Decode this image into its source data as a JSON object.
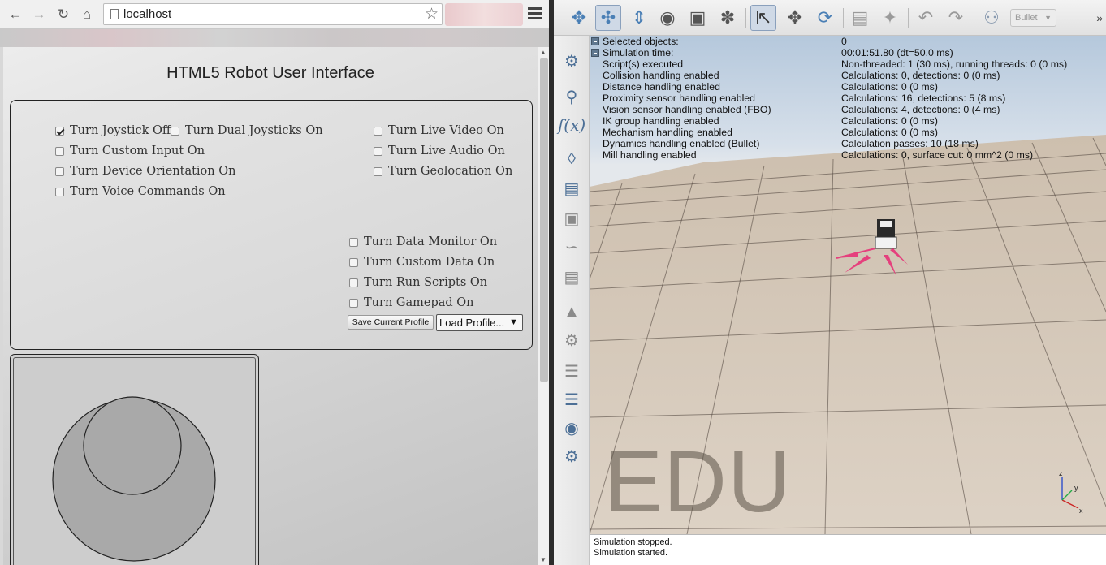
{
  "browser": {
    "url": "localhost",
    "page_title": "HTML5 Robot User Interface",
    "options_left": [
      {
        "label": "Turn Joystick Off",
        "checked": true
      },
      {
        "label": "Turn Dual Joysticks On",
        "checked": false
      },
      {
        "label": "Turn Custom Input On",
        "checked": false
      },
      {
        "label": "Turn Device Orientation On",
        "checked": false
      },
      {
        "label": "Turn Voice Commands On",
        "checked": false
      }
    ],
    "options_right": [
      {
        "label": "Turn Live Video On",
        "checked": false
      },
      {
        "label": "Turn Live Audio On",
        "checked": false
      },
      {
        "label": "Turn Geolocation On",
        "checked": false
      }
    ],
    "options_bottom": [
      {
        "label": "Turn Data Monitor On",
        "checked": false
      },
      {
        "label": "Turn Custom Data On",
        "checked": false
      },
      {
        "label": "Turn Run Scripts On",
        "checked": false
      },
      {
        "label": "Turn Gamepad On",
        "checked": false
      }
    ],
    "save_button": "Save Current Profile",
    "load_select": "Load Profile..."
  },
  "vrep": {
    "physics_engine": "Bullet",
    "info": [
      {
        "key": "Selected objects:",
        "value": "0"
      },
      {
        "key": "Simulation time:",
        "value": "00:01:51.80 (dt=50.0 ms)"
      },
      {
        "key": "Script(s) executed",
        "value": "Non-threaded: 1 (30 ms), running threads: 0 (0 ms)"
      },
      {
        "key": "Collision handling enabled",
        "value": "Calculations: 0, detections: 0 (0 ms)"
      },
      {
        "key": "Distance handling enabled",
        "value": "Calculations: 0 (0 ms)"
      },
      {
        "key": "Proximity sensor handling enabled",
        "value": "Calculations: 16, detections: 5 (8 ms)"
      },
      {
        "key": "Vision sensor handling enabled (FBO)",
        "value": "Calculations: 4, detections: 0 (4 ms)"
      },
      {
        "key": "IK group handling enabled",
        "value": "Calculations: 0 (0 ms)"
      },
      {
        "key": "Mechanism handling enabled",
        "value": "Calculations: 0 (0 ms)"
      },
      {
        "key": "Dynamics handling enabled (Bullet)",
        "value": "Calculation passes: 10 (18 ms)"
      },
      {
        "key": "Mill handling enabled",
        "value": "Calculations: 0, surface cut: 0 mm^2 (0 ms)"
      }
    ],
    "watermark": "EDU",
    "axes": {
      "x": "x",
      "y": "y",
      "z": "z"
    },
    "console": [
      "Simulation stopped.",
      "Simulation started."
    ]
  }
}
